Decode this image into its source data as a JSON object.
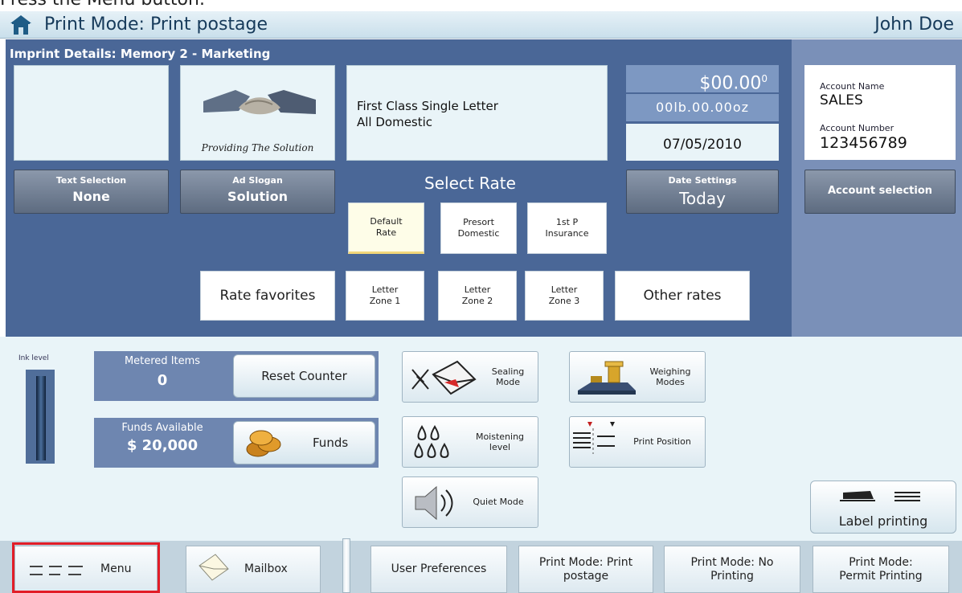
{
  "instruction": "Press the Menu button.",
  "title": "Print Mode: Print postage",
  "user": "John Doe",
  "imprint_header": "Imprint Details: Memory 2 - Marketing",
  "slogan_caption": "Providing The Solution",
  "rate_description": "First Class Single Letter\nAll Domestic",
  "amount": "$00.00",
  "amount_sup": "0",
  "weight": "00lb.00.00oz",
  "date": "07/05/2010",
  "account": {
    "name_label": "Account Name",
    "name_value": "SALES",
    "number_label": "Account Number",
    "number_value": "123456789",
    "selection_button": "Account selection"
  },
  "text_selection": {
    "label": "Text Selection",
    "value": "None"
  },
  "ad_slogan": {
    "label": "Ad Slogan",
    "value": "Solution"
  },
  "date_settings": {
    "label": "Date Settings",
    "value": "Today"
  },
  "select_rate": "Select Rate",
  "rate_buttons": {
    "default": "Default\nRate",
    "presort": "Presort\nDomestic",
    "insurance": "1st P\nInsurance",
    "favorites": "Rate favorites",
    "zone1": "Letter\nZone 1",
    "zone2": "Letter\nZone 2",
    "zone3": "Letter\nZone 3",
    "other": "Other rates"
  },
  "ink_label": "Ink level",
  "ink_level": 0.95,
  "metered": {
    "label": "Metered Items",
    "value": "0",
    "button": "Reset Counter"
  },
  "funds": {
    "label": "Funds Available",
    "value": "$ 20,000",
    "button": "Funds"
  },
  "functions": {
    "sealing": "Sealing\nMode",
    "weighing": "Weighing\nModes",
    "moistening": "Moistening\nlevel",
    "print_position": "Print Position",
    "quiet": "Quiet Mode",
    "label_printing": "Label printing"
  },
  "nav": {
    "menu": "Menu",
    "mailbox": "Mailbox",
    "preferences": "User Preferences",
    "print_postage": "Print Mode: Print\npostage",
    "no_printing": "Print Mode: No\nPrinting",
    "permit": "Print Mode:\nPermit Printing"
  },
  "colors": {
    "panel": "#4a6797",
    "side": "#7a90b8",
    "highlight": "#e21d27"
  }
}
